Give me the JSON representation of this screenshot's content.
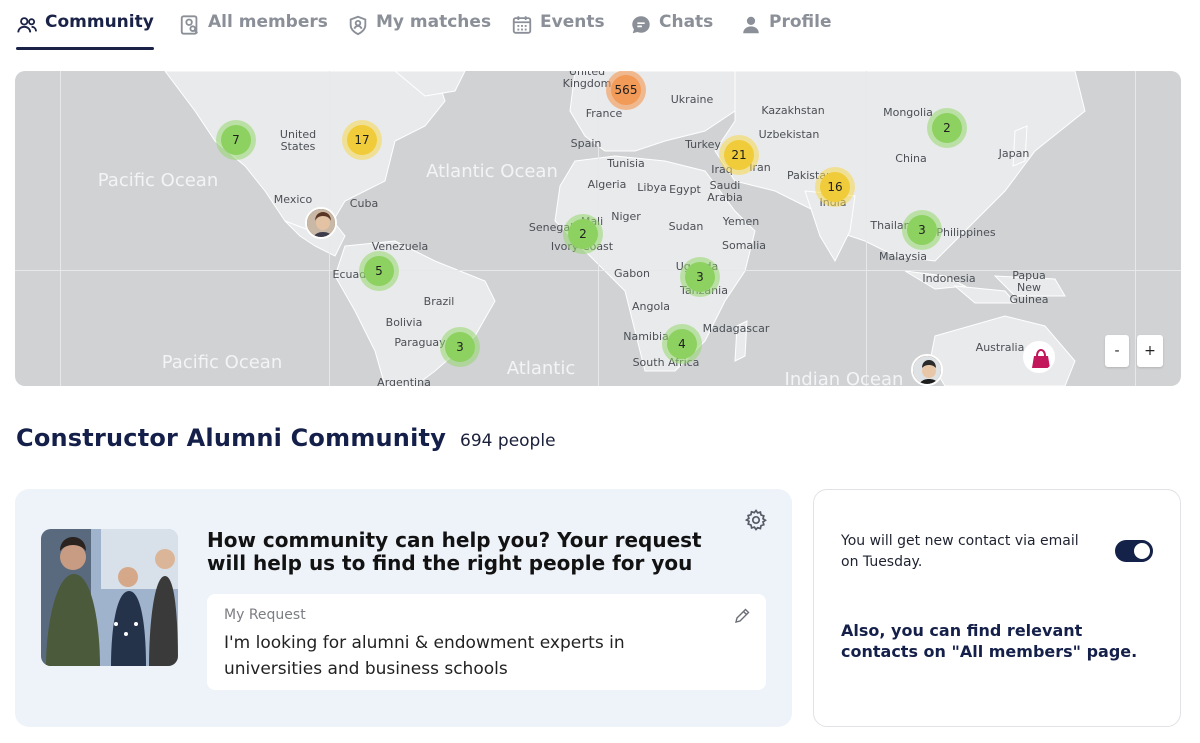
{
  "nav": {
    "tabs": [
      {
        "label": "Community",
        "icon": "people-icon",
        "active": true
      },
      {
        "label": "All members",
        "icon": "member-search-icon",
        "active": false
      },
      {
        "label": "My matches",
        "icon": "matches-icon",
        "active": false
      },
      {
        "label": "Events",
        "icon": "calendar-icon",
        "active": false
      },
      {
        "label": "Chats",
        "icon": "chat-bubble-icon",
        "active": false
      },
      {
        "label": "Profile",
        "icon": "person-icon",
        "active": false
      }
    ]
  },
  "map": {
    "oceans": [
      "Pacific Ocean",
      "Atlantic Ocean",
      "Pacific Ocean",
      "Atlantic",
      "Indian Ocean"
    ],
    "places": [
      "United Kingdom",
      "Ukraine",
      "Kazakhstan",
      "Mongolia",
      "United States",
      "France",
      "Uzbekistan",
      "Spain",
      "Turkey",
      "Japan",
      "Tunisia",
      "China",
      "Iraq",
      "Iran",
      "Pakistan",
      "Algeria",
      "Libya",
      "Egypt",
      "Saudi Arabia",
      "Mexico",
      "India",
      "Cuba",
      "Niger",
      "Senegal",
      "Mali",
      "Yemen",
      "Sudan",
      "Ivory Coast",
      "Thailand",
      "Philippines",
      "Venezuela",
      "Somalia",
      "Ecuador",
      "Malaysia",
      "Uganda",
      "Gabon",
      "Tanzania",
      "Indonesia",
      "Papua New Guinea",
      "Brazil",
      "Angola",
      "Bolivia",
      "Madagascar",
      "Namibia",
      "Paraguay",
      "South Africa",
      "Australia",
      "Argentina"
    ],
    "clusters": [
      {
        "count": "565",
        "level": "orange"
      },
      {
        "count": "7",
        "level": "green"
      },
      {
        "count": "17",
        "level": "yellow"
      },
      {
        "count": "21",
        "level": "yellow"
      },
      {
        "count": "2",
        "level": "green"
      },
      {
        "count": "16",
        "level": "yellow"
      },
      {
        "count": "2",
        "level": "green"
      },
      {
        "count": "3",
        "level": "green"
      },
      {
        "count": "5",
        "level": "green"
      },
      {
        "count": "3",
        "level": "green"
      },
      {
        "count": "3",
        "level": "green"
      },
      {
        "count": "4",
        "level": "green"
      }
    ],
    "zoom_out": "-",
    "zoom_in": "+"
  },
  "community": {
    "title": "Constructor Alumni Community",
    "count": "694",
    "count_unit": "people"
  },
  "request": {
    "title": "How community can help you? Your request will help us to find the right people for you",
    "label": "My Request",
    "text": "I'm looking for alumni & endowment experts in universities and business schools"
  },
  "contact": {
    "email_text": "You will get new contact via email on Tuesday.",
    "toggle_on": true,
    "note": "Also, you can find relevant contacts on \"All members\" page."
  },
  "colors": {
    "primary": "#15204a",
    "inactive_tab": "#8b8f98",
    "map_water": "#d0d2d4",
    "map_land": "#e9eaeb",
    "cluster_green": "#8dd161",
    "cluster_yellow": "#f0cc3a",
    "cluster_orange": "#f29a57",
    "request_bg": "#eef3fa"
  }
}
